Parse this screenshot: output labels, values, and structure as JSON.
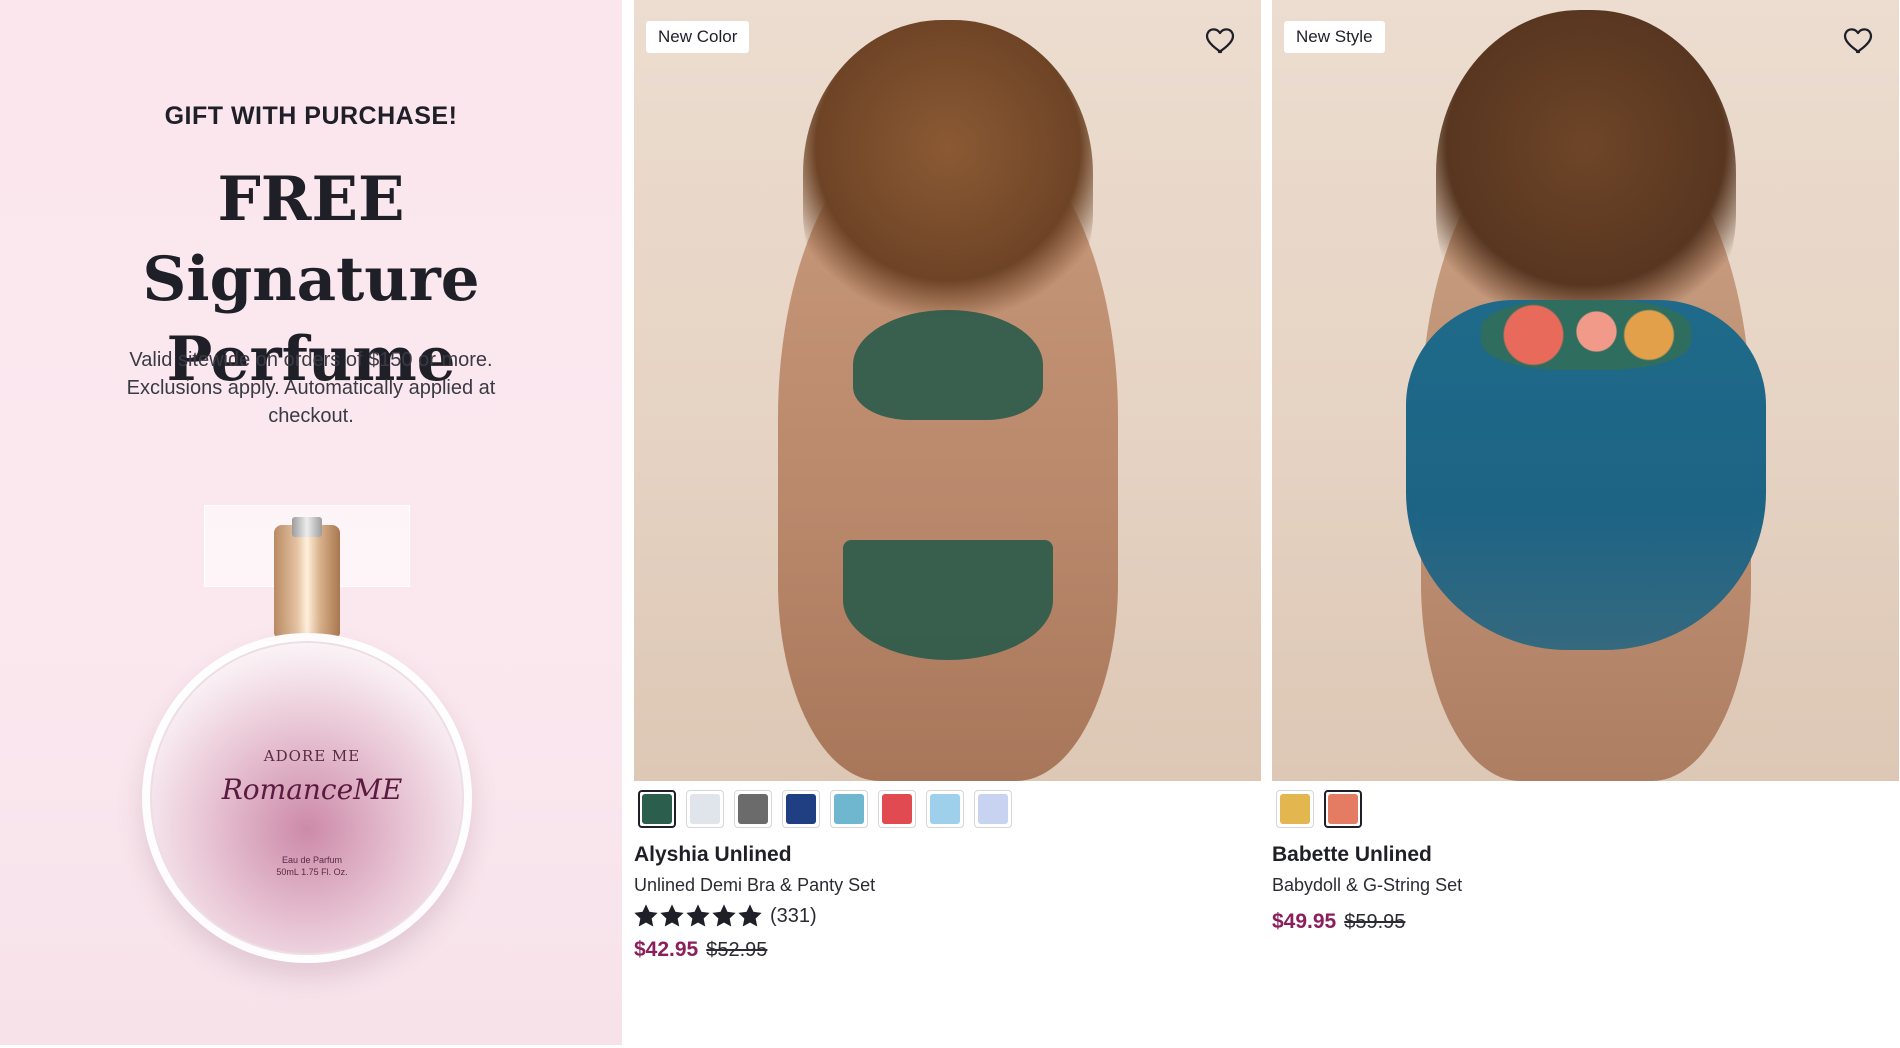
{
  "promo": {
    "eyebrow": "GIFT WITH PURCHASE!",
    "headline": "FREE Signature Perfume",
    "terms": "Valid sitewide on orders of $150 or more. Exclusions apply. Automatically applied at checkout.",
    "bottle": {
      "brand": "ADORE ME",
      "name": "RomanceME",
      "line1": "Eau de Parfum",
      "line2": "50mL 1.75 Fl. Oz."
    }
  },
  "products": [
    {
      "badge": "New Color",
      "name": "Alyshia Unlined",
      "description": "Unlined Demi Bra & Panty Set",
      "rating": 5,
      "review_count": "(331)",
      "sale_price": "$42.95",
      "original_price": "$52.95",
      "swatches": [
        {
          "color": "#2c5e4e",
          "selected": true
        },
        {
          "color": "#dfe5ea",
          "selected": false
        },
        {
          "color": "#6b6b6b",
          "selected": false
        },
        {
          "color": "#1f3f82",
          "selected": false
        },
        {
          "color": "#6fb6cf",
          "selected": false
        },
        {
          "color": "#e24a52",
          "selected": false
        },
        {
          "color": "#9ed0ec",
          "selected": false
        },
        {
          "color": "#c8d3f2",
          "selected": false
        }
      ]
    },
    {
      "badge": "New Style",
      "name": "Babette Unlined",
      "description": "Babydoll & G-String Set",
      "sale_price": "$49.95",
      "original_price": "$59.95",
      "swatches": [
        {
          "color": "#e4b64f",
          "selected": false
        },
        {
          "color": "#e47c63",
          "selected": true
        }
      ]
    }
  ],
  "colors": {
    "sale_price": "#8a1f5c",
    "promo_background": "#fbe6ee",
    "text": "#1f1f28"
  },
  "icons": {
    "wishlist": "heart-outline-icon",
    "rating": "star-icon"
  }
}
